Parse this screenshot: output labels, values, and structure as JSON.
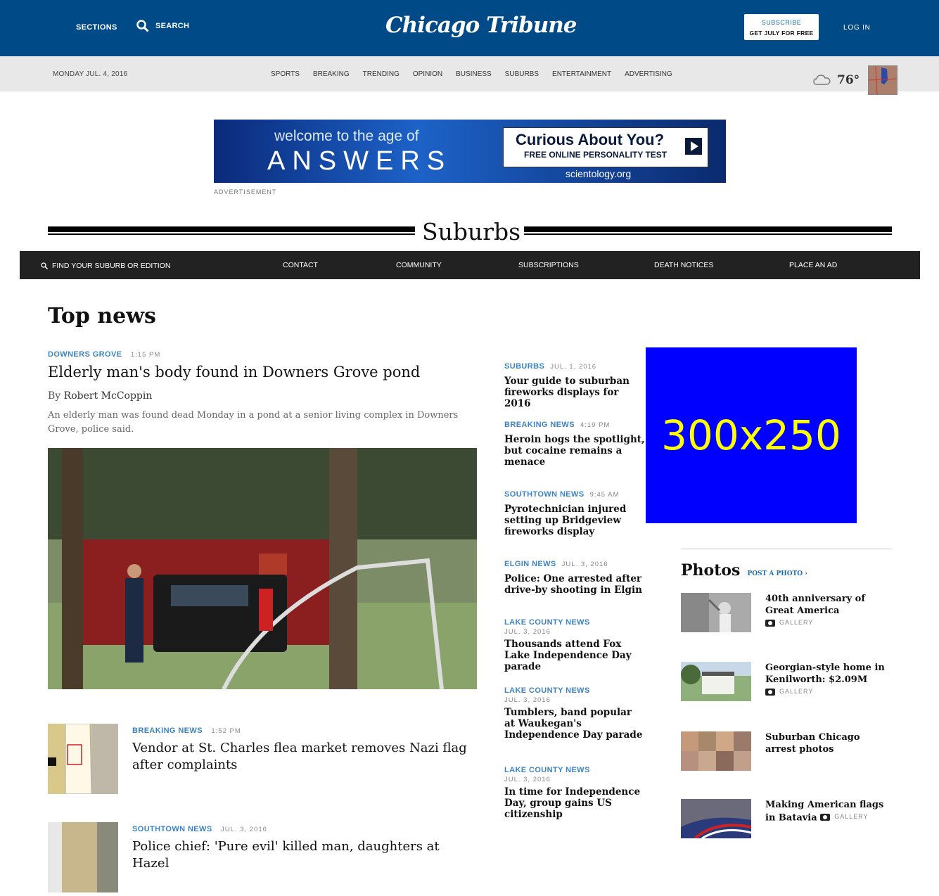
{
  "header": {
    "sections_label": "SECTIONS",
    "search_label": "SEARCH",
    "logo_text": "Chicago Tribune",
    "subscribe_line1": "SUBSCRIBE",
    "subscribe_line2": "GET JULY FOR FREE",
    "login_label": "LOG IN"
  },
  "navbar": {
    "date": "MONDAY JUL. 4, 2016",
    "links": [
      "SPORTS",
      "BREAKING",
      "TRENDING",
      "OPINION",
      "BUSINESS",
      "SUBURBS",
      "ENTERTAINMENT",
      "ADVERTISING"
    ],
    "temperature": "76°"
  },
  "banner_ad": {
    "welcome": "welcome to the age of",
    "answers": "ANSWERS",
    "question": "Curious About You?",
    "offer": "FREE ONLINE PERSONALITY TEST",
    "url": "scientology.org",
    "label": "ADVERTISEMENT"
  },
  "section": {
    "title": "Suburbs",
    "find_label": "FIND YOUR SUBURB OR EDITION",
    "nav": [
      "CONTACT",
      "COMMUNITY",
      "SUBSCRIPTIONS",
      "DEATH NOTICES",
      "PLACE AN AD"
    ]
  },
  "top_news": {
    "heading": "Top news",
    "lead": {
      "kicker": "DOWNERS GROVE",
      "time": "1:15 PM",
      "headline": "Elderly man's body found in Downers Grove pond",
      "by": "By",
      "author": "Robert McCoppin",
      "summary": "An elderly man was found dead Monday in a pond at a senior living complex in Downers Grove, police said."
    },
    "stories": [
      {
        "kicker": "BREAKING NEWS",
        "time": "1:52 PM",
        "headline": "Vendor at St. Charles flea market removes Nazi flag after complaints"
      },
      {
        "kicker": "SOUTHTOWN NEWS",
        "time": "JUL. 3, 2016",
        "headline": "Police chief: 'Pure evil' killed man, daughters at Hazel"
      }
    ]
  },
  "mid_column": [
    {
      "kicker": "SUBURBS",
      "time": "JUL. 1, 2016",
      "headline": "Your guide to suburban fireworks displays for 2016"
    },
    {
      "kicker": "BREAKING NEWS",
      "time": "4:19 PM",
      "headline": "Heroin hogs the spotlight, but cocaine remains a menace"
    },
    {
      "kicker": "SOUTHTOWN NEWS",
      "time": "9:45 AM",
      "headline": "Pyrotechnician injured setting up Bridgeview fireworks display"
    },
    {
      "kicker": "ELGIN NEWS",
      "time": "JUL. 3, 2016",
      "headline": "Police: One arrested after drive-by shooting in Elgin"
    },
    {
      "kicker": "LAKE COUNTY NEWS",
      "date": "JUL. 3, 2016",
      "headline": "Thousands attend Fox Lake Independence Day parade"
    },
    {
      "kicker": "LAKE COUNTY NEWS",
      "date": "JUL. 3, 2016",
      "headline": "Tumblers, band popular at Waukegan's Independence Day parade"
    },
    {
      "kicker": "LAKE COUNTY NEWS",
      "date": "JUL. 3, 2016",
      "headline": "In time for Independence Day, group gains US citizenship"
    }
  ],
  "ad_box": {
    "text": "300x250"
  },
  "photos": {
    "title": "Photos",
    "post_label": "POST A PHOTO ›",
    "gallery_label": "GALLERY",
    "items": [
      {
        "title": "40th anniversary of Great America",
        "gallery": true
      },
      {
        "title": "Georgian-style home in Kenilworth: $2.09M",
        "gallery": true
      },
      {
        "title": "Suburban Chicago arrest photos",
        "gallery": false
      },
      {
        "title": "Making American flags in Batavia",
        "gallery": true
      }
    ]
  }
}
